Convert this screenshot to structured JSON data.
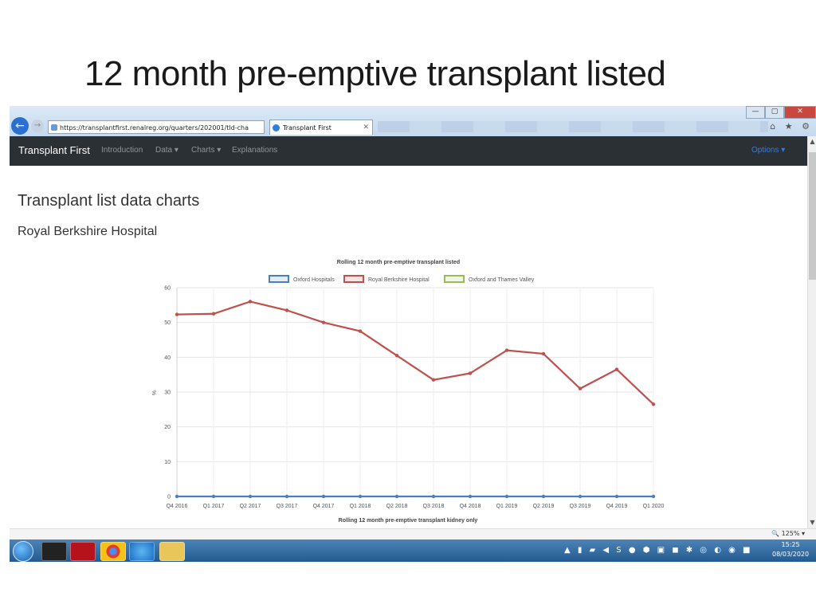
{
  "slide": {
    "title": "12 month pre-emptive transplant listed"
  },
  "browser": {
    "address": "https://transplantfirst.renalreg.org/quarters/202001/tld-cha",
    "address_tools": "⌕ ▾ 🔒 ↻",
    "tab_title": "Transplant First",
    "tab_close": "✕",
    "window_buttons": [
      "—",
      "▢",
      "✕"
    ],
    "chrome_icons": "⌂ ★ ⚙",
    "zoom": "🔍 125%  ▾"
  },
  "navbar": {
    "brand": "Transplant First",
    "links": [
      "Introduction",
      "Data ▾",
      "Charts ▾",
      "Explanations"
    ],
    "options": "Options ▾"
  },
  "page": {
    "heading": "Transplant list data charts",
    "subheading": "Royal Berkshire Hospital"
  },
  "chart_data": {
    "type": "line",
    "title": "Rolling 12 month pre-emptive transplant listed",
    "xlabel": "Rolling 12 month pre-emptive transplant kidney only",
    "ylabel": "%",
    "ylim": [
      0,
      60
    ],
    "yticks": [
      0,
      10,
      20,
      30,
      40,
      50,
      60
    ],
    "grid": true,
    "legend_position": "top",
    "categories": [
      "Q4 2016",
      "Q1 2017",
      "Q2 2017",
      "Q3 2017",
      "Q4 2017",
      "Q1 2018",
      "Q2 2018",
      "Q3 2018",
      "Q4 2018",
      "Q1 2019",
      "Q2 2019",
      "Q3 2019",
      "Q4 2019",
      "Q1 2020"
    ],
    "series": [
      {
        "name": "Oxford Hospitals",
        "color": "#4a7fbf",
        "values": [
          0,
          0,
          0,
          0,
          0,
          0,
          0,
          0,
          0,
          0,
          0,
          0,
          0,
          0
        ]
      },
      {
        "name": "Royal Berkshire Hospital",
        "color": "#c0504d",
        "values": [
          52.3,
          52.5,
          56,
          53.5,
          50,
          47.5,
          40.5,
          33.5,
          35.4,
          42,
          41,
          31,
          36.5,
          26.5
        ]
      },
      {
        "name": "Oxford and Thames Valley",
        "color": "#9bbb59",
        "values": []
      }
    ]
  },
  "taskbar": {
    "tray_icons": "▲ ▮ ▰ ◀ S ● ⬢ ▣ ◼ ✱ ◎ ◐ ◉ ■",
    "time": "15:25",
    "date": "08/03/2020"
  }
}
